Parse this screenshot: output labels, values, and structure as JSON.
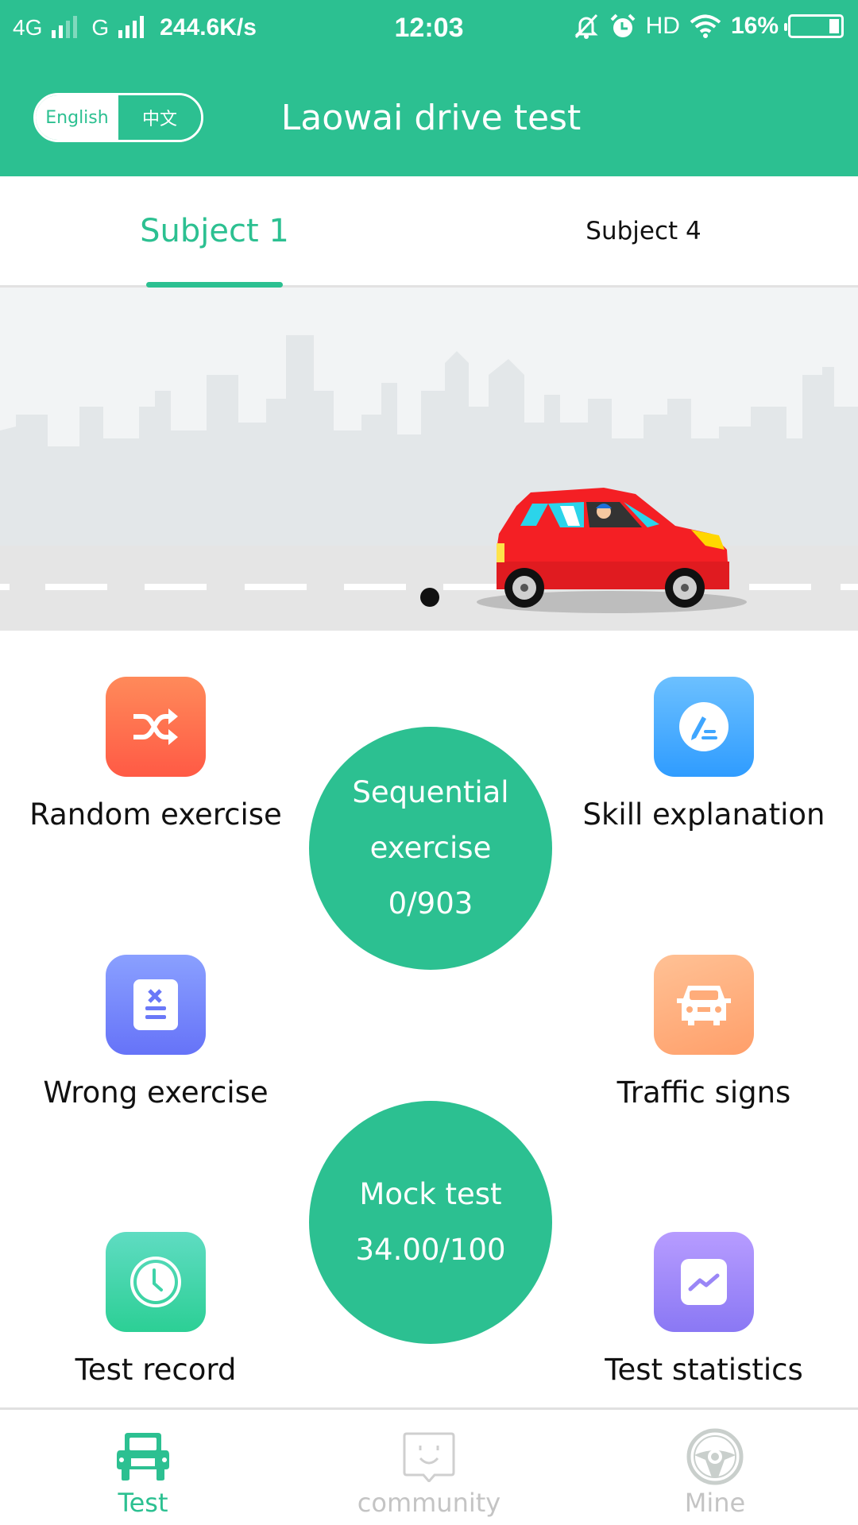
{
  "status_bar": {
    "network1": "4G",
    "network2": "G",
    "speed": "244.6K/s",
    "time": "12:03",
    "hd": "HD",
    "battery": "16%",
    "battery_level": 0.16
  },
  "header": {
    "lang_options": [
      "English",
      "中文"
    ],
    "selected_lang": "English",
    "title": "Laowai drive test"
  },
  "tabs": [
    {
      "label": "Subject 1",
      "active": true
    },
    {
      "label": "Subject 4",
      "active": false
    }
  ],
  "banner": {
    "page_count": 1,
    "current_page": 1
  },
  "features": {
    "random_exercise": "Random exercise",
    "skill_explanation": "Skill explanation",
    "wrong_exercise": "Wrong exercise",
    "traffic_signs": "Traffic signs",
    "test_record": "Test record",
    "test_statistics": "Test statistics"
  },
  "sequential": {
    "line1": "Sequential",
    "line2": "exercise",
    "progress": "0/903"
  },
  "mock": {
    "line1": "Mock test",
    "score": "34.00/100"
  },
  "bottom_nav": [
    {
      "label": "Test",
      "icon": "car-icon",
      "active": true
    },
    {
      "label": "community",
      "icon": "chat-smile-icon",
      "active": false
    },
    {
      "label": "Mine",
      "icon": "steering-wheel-icon",
      "active": false
    }
  ],
  "colors": {
    "brand": "#2cc091",
    "inactive": "#c4c4c4"
  }
}
